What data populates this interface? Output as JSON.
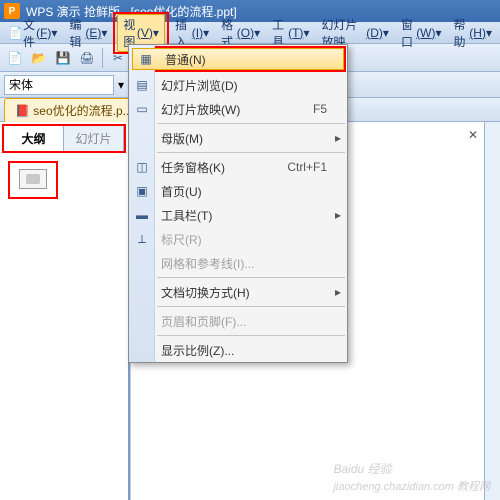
{
  "title": "WPS 演示 抢鲜版 - [seo优化的流程.ppt]",
  "menubar": {
    "file": "文件",
    "file_h": "(F)",
    "edit": "编辑",
    "edit_h": "(E)",
    "view": "视图",
    "view_h": "(V)",
    "insert": "插入",
    "insert_h": "(I)",
    "format": "格式",
    "format_h": "(O)",
    "tools": "工具",
    "tools_h": "(T)",
    "slideshow": "幻灯片放映",
    "slideshow_h": "(D)",
    "window": "窗口",
    "window_h": "(W)",
    "help": "帮助",
    "help_h": "(H)"
  },
  "fontbar": {
    "font": "宋体"
  },
  "tabbar": {
    "doc": "seo优化的流程.p..."
  },
  "sidebar": {
    "outline": "大纲",
    "slides": "幻灯片"
  },
  "dropdown": {
    "normal": "普通(N)",
    "browse": "幻灯片浏览(D)",
    "play": "幻灯片放映(W)",
    "play_sc": "F5",
    "master": "母版(M)",
    "taskpane": "任务窗格(K)",
    "taskpane_sc": "Ctrl+F1",
    "home": "首页(U)",
    "toolbar": "工具栏(T)",
    "ruler": "标尺(R)",
    "grid": "网格和参考线(I)...",
    "switch": "文档切换方式(H)",
    "hf": "页眉和页脚(F)...",
    "zoom": "显示比例(Z)..."
  },
  "watermark": {
    "main": "Baidu 经验",
    "sub": "jiaocheng.chazidian.com 教程网"
  }
}
